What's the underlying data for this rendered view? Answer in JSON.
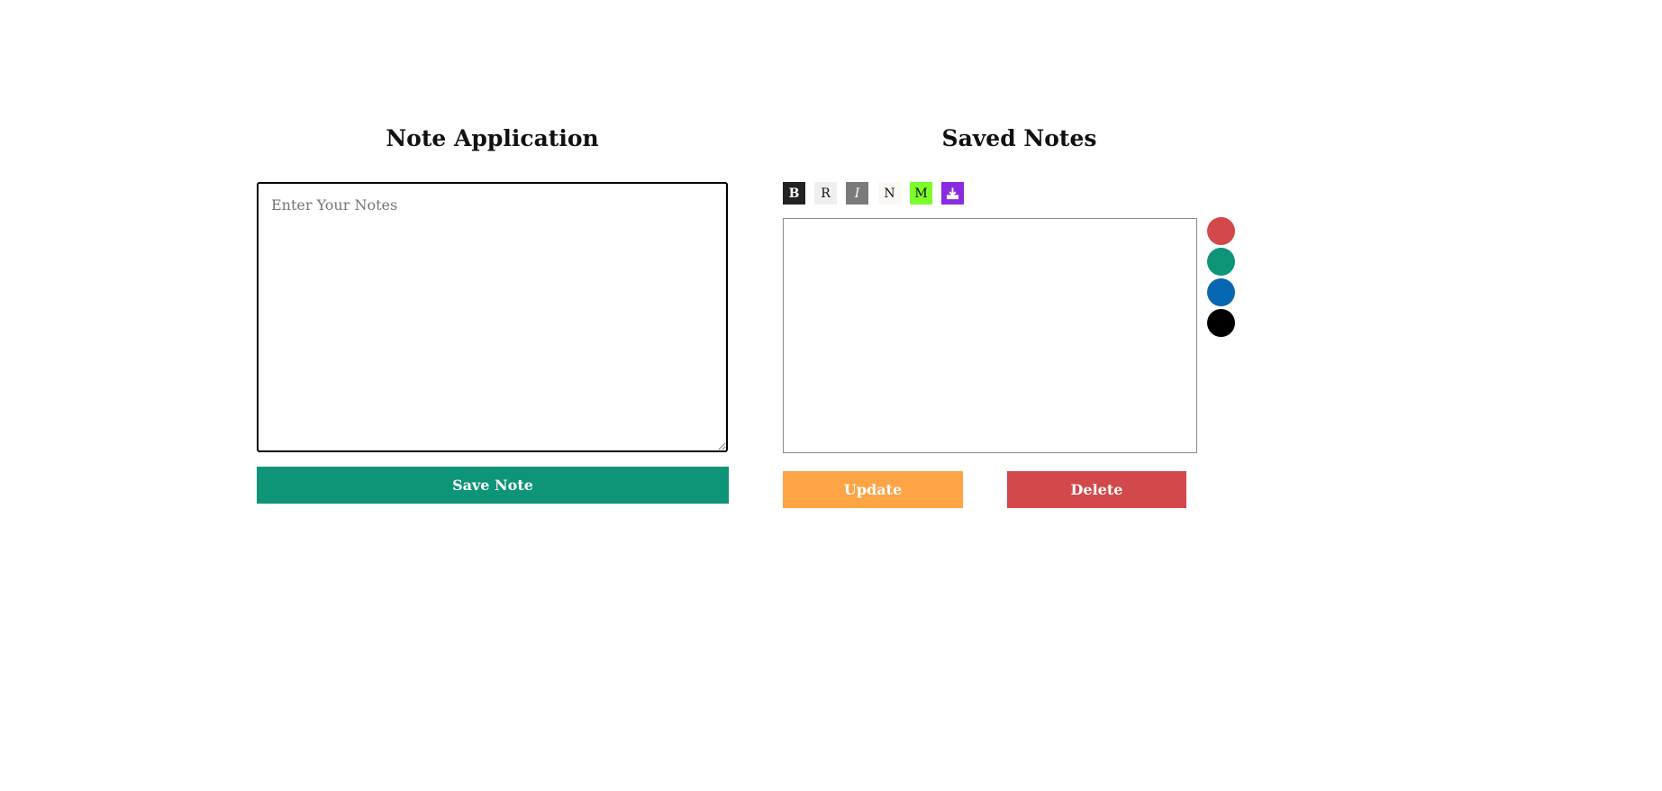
{
  "left_panel": {
    "title": "Note Application",
    "note_input_placeholder": "Enter Your Notes",
    "note_input_value": "",
    "save_label": "Save Note"
  },
  "right_panel": {
    "title": "Saved Notes",
    "toolbar": {
      "bold_label": "B",
      "regular_label": "R",
      "italic_label": "I",
      "normal_label": "N",
      "mark_label": "M",
      "download_icon": "download-icon"
    },
    "saved_notes_content": "",
    "update_label": "Update",
    "delete_label": "Delete",
    "color_swatches": [
      "#d2484b",
      "#0e9477",
      "#0767b1",
      "#000000"
    ]
  },
  "colors": {
    "save_button": "#0e9477",
    "update_button": "#fea445",
    "delete_button": "#d2484b",
    "download_button": "#8a2be2",
    "mark_button": "#7cfc2a"
  }
}
